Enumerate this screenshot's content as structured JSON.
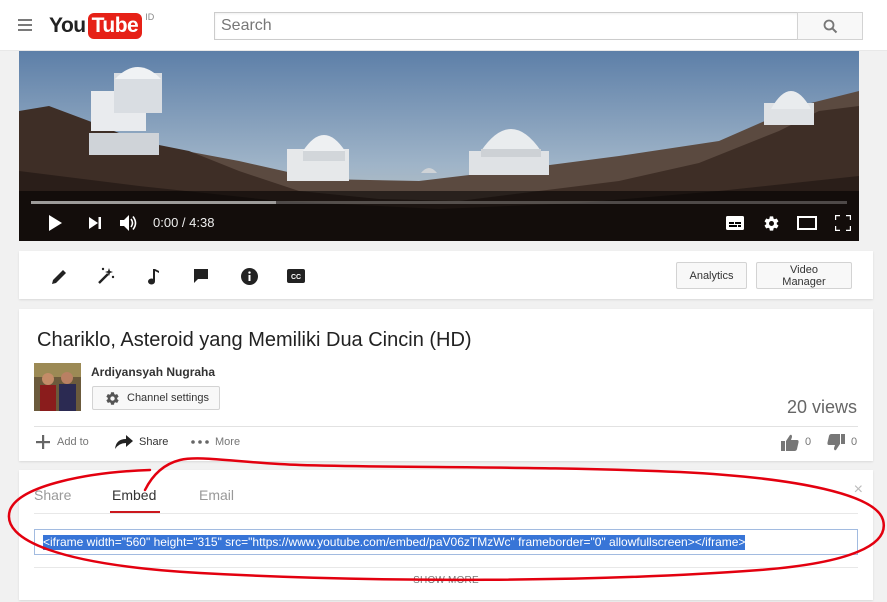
{
  "masthead": {
    "logo_you": "You",
    "logo_tube": "Tube",
    "region": "ID",
    "search_placeholder": "Search"
  },
  "player": {
    "time": "0:00 / 4:38",
    "buffered_fraction": 0.3
  },
  "toolbar": {
    "icons": [
      "pencil-icon",
      "magic-wand-icon",
      "music-note-icon",
      "annotations-icon",
      "info-icon",
      "cc-icon"
    ],
    "analytics_label": "Analytics",
    "video_manager_label": "Video Manager"
  },
  "video": {
    "title": "Chariklo, Asteroid yang Memiliki Dua Cincin (HD)",
    "channel": "Ardiyansyah Nugraha",
    "channel_settings_label": "Channel settings",
    "views": "20 views",
    "actions": {
      "add_to": "Add to",
      "share": "Share",
      "more": "More"
    },
    "likes": "0",
    "dislikes": "0"
  },
  "share_panel": {
    "tabs": [
      "Share",
      "Embed",
      "Email"
    ],
    "active_tab": "Embed",
    "embed_code": "<iframe width=\"560\" height=\"315\" src=\"https://www.youtube.com/embed/paV06zTMzWc\" frameborder=\"0\" allowfullscreen></iframe>",
    "show_more": "SHOW MORE",
    "close": "×"
  },
  "colors": {
    "youtube_red": "#e62117",
    "selection_blue": "#3875d7",
    "annotation_red": "#e3000f"
  }
}
